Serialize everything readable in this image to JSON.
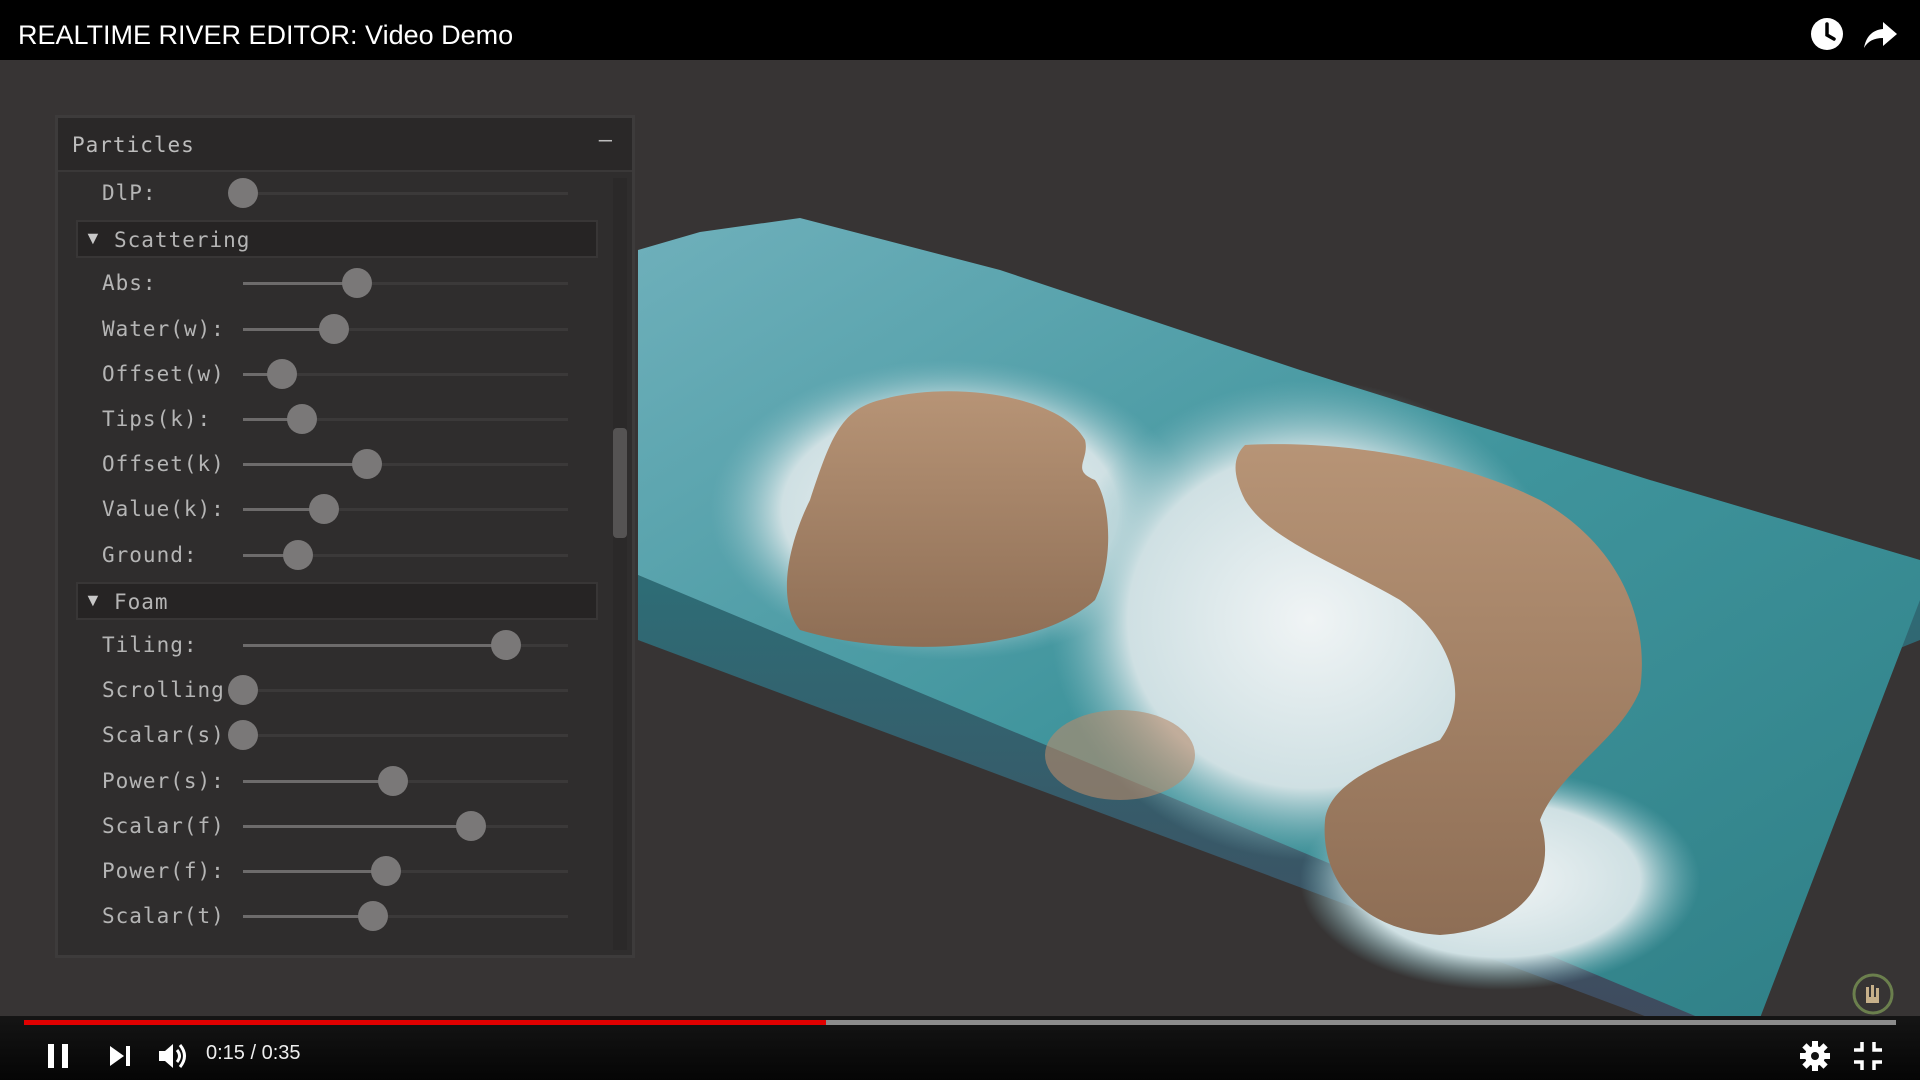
{
  "video": {
    "title": "REALTIME RIVER EDITOR: Video Demo",
    "current_time": "0:15",
    "separator": " / ",
    "duration": "0:35",
    "progress": 0.4286
  },
  "top_icons": [
    "clock-icon",
    "share-arrow-icon"
  ],
  "panel": {
    "title": "Particles",
    "collapse_symbol": "–",
    "rows": [
      {
        "kind": "slider",
        "label": "DlP:",
        "value": 0.0
      },
      {
        "kind": "section",
        "label": "Scattering",
        "arrow": "▼"
      },
      {
        "kind": "slider",
        "label": "Abs:",
        "value": 0.35
      },
      {
        "kind": "slider",
        "label": "Water(w):",
        "value": 0.28
      },
      {
        "kind": "slider",
        "label": "Offset(w)",
        "value": 0.12
      },
      {
        "kind": "slider",
        "label": "Tips(k):",
        "value": 0.18
      },
      {
        "kind": "slider",
        "label": "Offset(k)",
        "value": 0.38
      },
      {
        "kind": "slider",
        "label": "Value(k):",
        "value": 0.25
      },
      {
        "kind": "slider",
        "label": "Ground:",
        "value": 0.17
      },
      {
        "kind": "section",
        "label": "Foam",
        "arrow": "▼"
      },
      {
        "kind": "slider",
        "label": "Tiling:",
        "value": 0.81
      },
      {
        "kind": "slider",
        "label": "Scrolling",
        "value": 0.0
      },
      {
        "kind": "slider",
        "label": "Scalar(s)",
        "value": 0.0
      },
      {
        "kind": "slider",
        "label": "Power(s):",
        "value": 0.46
      },
      {
        "kind": "slider",
        "label": "Scalar(f)",
        "value": 0.7
      },
      {
        "kind": "slider",
        "label": "Power(f):",
        "value": 0.44
      },
      {
        "kind": "slider",
        "label": "Scalar(t)",
        "value": 0.4
      }
    ]
  },
  "control_icons": [
    "pause-icon",
    "next-icon",
    "volume-icon",
    "settings-gear-icon",
    "exit-fullscreen-icon"
  ],
  "colors": {
    "progress_played": "#e00000",
    "panel_bg": "#2f2d2d",
    "island": "#a9876a",
    "water": "#3a8f98",
    "foam": "#dfe8ea"
  }
}
